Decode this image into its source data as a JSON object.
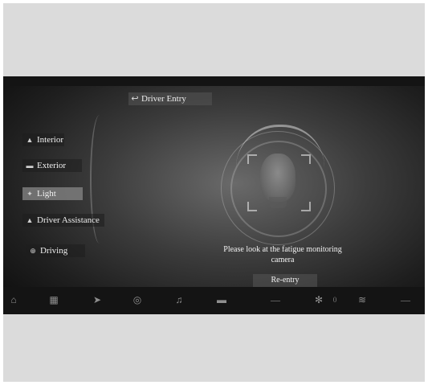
{
  "header": {
    "back_icon": "back-arrow-icon",
    "title": "Driver Entry"
  },
  "sidebar": {
    "items": [
      {
        "label": "Interior",
        "icon": "car-interior-icon"
      },
      {
        "label": "Exterior",
        "icon": "car-exterior-icon"
      },
      {
        "label": "Light",
        "icon": "light-icon",
        "active": true
      },
      {
        "label": "Driver Assistance",
        "icon": "driver-assistance-icon"
      },
      {
        "label": "Driving",
        "icon": "steering-icon"
      }
    ]
  },
  "main": {
    "message": "Please look at the fatigue monitoring camera",
    "reentry_label": "Re-entry"
  },
  "bottom_bar": {
    "icons": [
      "home-icon",
      "apps-icon",
      "navigation-icon",
      "media-icon",
      "music-icon",
      "car-icon",
      "fan-icon",
      "seat-heat-icon"
    ],
    "fan_level": "0"
  },
  "colors": {
    "screen_bg": "#1f1f1f",
    "frame_bg": "#dbdbdb",
    "active_item": "#828282",
    "text": "#f0f0f0"
  }
}
